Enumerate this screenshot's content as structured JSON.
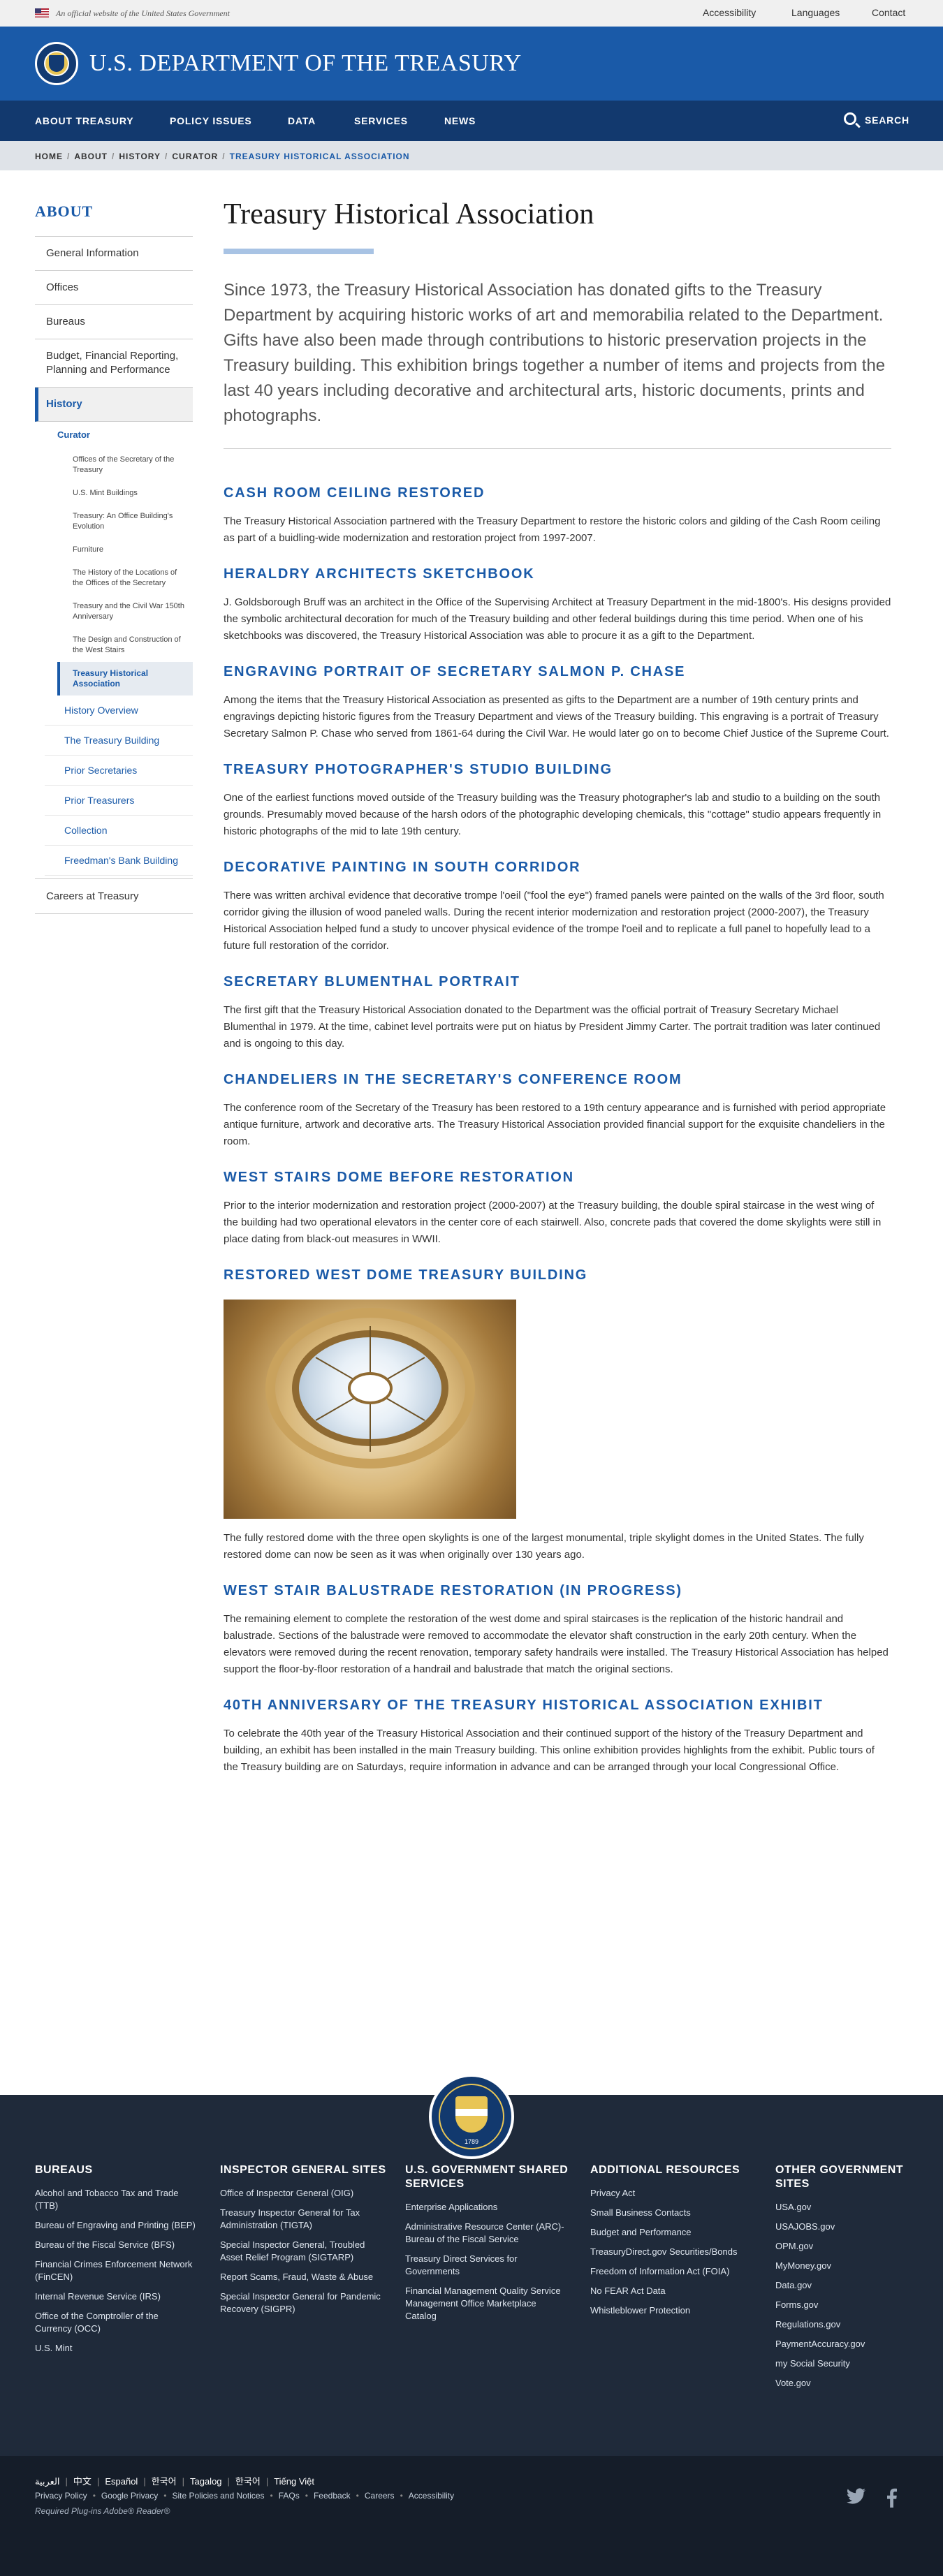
{
  "banner": {
    "official": "An official website of the United States Government",
    "accessibility": "Accessibility",
    "languages": "Languages",
    "contact": "Contact"
  },
  "header": {
    "title": "U.S. DEPARTMENT OF THE TREASURY"
  },
  "nav": {
    "items": [
      "ABOUT TREASURY",
      "POLICY ISSUES",
      "DATA",
      "SERVICES",
      "NEWS"
    ],
    "search": "SEARCH"
  },
  "breadcrumb": [
    "HOME",
    "ABOUT",
    "HISTORY",
    "CURATOR",
    "TREASURY HISTORICAL ASSOCIATION"
  ],
  "sidebar": {
    "heading": "ABOUT",
    "items": [
      "General Information",
      "Offices",
      "Bureaus",
      "Budget, Financial Reporting, Planning and Performance",
      "History"
    ],
    "curator": "Curator",
    "curator_sub": [
      "Offices of the Secretary of the Treasury",
      "U.S. Mint Buildings",
      "Treasury: An Office Building's Evolution",
      "Furniture",
      "The History of the Locations of the Offices of the Secretary",
      "Treasury and the Civil War 150th Anniversary",
      "The Design and Construction of the West Stairs",
      "Treasury Historical Association"
    ],
    "history_sub": [
      "History Overview",
      "The Treasury Building",
      "Prior Secretaries",
      "Prior Treasurers",
      "Collection",
      "Freedman's Bank Building"
    ],
    "careers": "Careers at Treasury"
  },
  "main": {
    "title": "Treasury Historical Association",
    "lede": "Since 1973, the Treasury Historical Association has donated gifts to the Treasury Department by acquiring historic works of art and memorabilia related to the Department. Gifts have also been made through contributions to historic preservation projects in the Treasury building. This exhibition brings together a number of items and projects from the last 40 years including decorative and architectural arts, historic documents, prints and photographs.",
    "sections": [
      {
        "heading": "CASH ROOM CEILING RESTORED",
        "text": "The Treasury Historical Association partnered with the Treasury Department to restore the historic colors and gilding of the Cash Room ceiling as part of a buidling-wide modernization and restoration project from 1997-2007."
      },
      {
        "heading": "HERALDRY ARCHITECTS SKETCHBOOK",
        "text": "J. Goldsborough Bruff was an architect in the Office of the Supervising Architect at Treasury Department in the mid-1800's. His designs provided the symbolic architectural decoration for much of the Treasury building and other federal buildings during this time period. When one of his sketchbooks was discovered, the Treasury Historical Association was able to procure it as a gift to the Department."
      },
      {
        "heading": "ENGRAVING PORTRAIT OF SECRETARY SALMON P. CHASE",
        "text": "Among the items that the Treasury Historical Association as presented as gifts to the Department are a number of 19th century prints and engravings depicting historic figures from the Treasury Department and views of the Treasury building. This engraving is a portrait of Treasury Secretary Salmon P. Chase who served from 1861-64 during the Civil War. He would later go on to become Chief Justice of the Supreme Court."
      },
      {
        "heading": "TREASURY PHOTOGRAPHER'S STUDIO BUILDING",
        "text": "One of the earliest functions moved outside of the Treasury building was the Treasury photographer's lab and studio to a building on the south grounds. Presumably moved because of the harsh odors of the photographic developing chemicals, this \"cottage\" studio appears frequently in historic photographs of the mid to late 19th century."
      },
      {
        "heading": "DECORATIVE PAINTING IN SOUTH CORRIDOR",
        "text": "There was written archival evidence that decorative trompe l'oeil (\"fool the eye\") framed panels were painted on the walls of the 3rd floor, south corridor giving the illusion of wood paneled walls. During the recent interior modernization and restoration project (2000-2007), the Treasury Historical Association helped fund a study to uncover physical evidence of the trompe l'oeil and to replicate a full panel to hopefully lead to a future full restoration of the corridor."
      },
      {
        "heading": "SECRETARY BLUMENTHAL PORTRAIT",
        "text": "The first gift that the Treasury Historical Association donated to the Department was the official portrait of Treasury Secretary Michael Blumenthal in 1979. At the time, cabinet level portraits were put on hiatus by President Jimmy Carter. The portrait tradition was later continued and is ongoing to this day."
      },
      {
        "heading": "CHANDELIERS IN THE SECRETARY'S CONFERENCE ROOM",
        "text": "The conference room of the Secretary of the Treasury has been restored to a 19th century appearance and is furnished with period appropriate antique furniture, artwork and decorative arts. The Treasury Historical Association provided financial support for the exquisite chandeliers in the room."
      },
      {
        "heading": "WEST STAIRS DOME BEFORE RESTORATION",
        "text": "Prior to the interior modernization and restoration project (2000-2007) at the Treasury building, the double spiral staircase in the west wing of the building had two operational elevators in the center core of each stairwell. Also, concrete pads that covered the dome skylights were still in place dating from black-out measures in WWII."
      }
    ],
    "dome_heading": "RESTORED WEST DOME TREASURY BUILDING",
    "dome_text": "The fully restored dome with the three open skylights is one of the largest monumental, triple skylight domes in the United States. The fully restored dome can now be seen as it was when originally over 130 years ago.",
    "sections_after": [
      {
        "heading": "WEST STAIR BALUSTRADE RESTORATION (IN PROGRESS)",
        "text": "The remaining element to complete the restoration of the west dome and spiral staircases is the replication of the historic handrail and balustrade. Sections of the balustrade were removed to accommodate the elevator shaft construction in the early 20th century. When the elevators were removed during the recent renovation, temporary safety handrails were installed. The Treasury Historical Association has helped support the floor-by-floor restoration of a handrail and balustrade that match the original sections."
      },
      {
        "heading": "40TH ANNIVERSARY OF THE TREASURY HISTORICAL ASSOCIATION EXHIBIT",
        "text": "To celebrate the 40th year of the Treasury Historical Association and their continued support of the history of the Treasury Department and building, an exhibit has been installed in the main Treasury building. This online exhibition provides highlights from the exhibit. Public tours of the Treasury building are on Saturdays, require information in advance and can be arranged through your local Congressional Office."
      }
    ]
  },
  "footer": {
    "seal_year": "1789",
    "columns": [
      {
        "heading": "BUREAUS",
        "links": [
          "Alcohol and Tobacco Tax and Trade (TTB)",
          "Bureau of Engraving and Printing (BEP)",
          "Bureau of the Fiscal Service (BFS)",
          "Financial Crimes Enforcement Network (FinCEN)",
          "Internal Revenue Service (IRS)",
          "Office of the Comptroller of the Currency (OCC)",
          "U.S. Mint"
        ]
      },
      {
        "heading": "INSPECTOR GENERAL SITES",
        "links": [
          "Office of Inspector General (OIG)",
          "Treasury Inspector General for Tax Administration (TIGTA)",
          "Special Inspector General, Troubled Asset Relief Program (SIGTARP)",
          "Report Scams, Fraud, Waste & Abuse",
          "Special Inspector General for Pandemic Recovery (SIGPR)"
        ]
      },
      {
        "heading": "U.S. GOVERNMENT SHARED SERVICES",
        "links": [
          "Enterprise Applications",
          "Administrative Resource Center (ARC)- Bureau of the Fiscal Service",
          "Treasury Direct Services for Governments",
          "Financial Management Quality Service Management Office Marketplace Catalog"
        ]
      },
      {
        "heading": "ADDITIONAL RESOURCES",
        "links": [
          "Privacy Act",
          "Small Business Contacts",
          "Budget and Performance",
          "TreasuryDirect.gov Securities/Bonds",
          "Freedom of Information Act (FOIA)",
          "No FEAR Act Data",
          "Whistleblower Protection"
        ]
      },
      {
        "heading": "OTHER GOVERNMENT SITES",
        "links": [
          "USA.gov",
          "USAJOBS.gov",
          "OPM.gov",
          "MyMoney.gov",
          "Data.gov",
          "Forms.gov",
          "Regulations.gov",
          "PaymentAccuracy.gov",
          "my Social Security",
          "Vote.gov"
        ]
      }
    ],
    "languages": [
      "العربية",
      "中文",
      "Español",
      "한국어",
      "Tagalog",
      "한국어",
      "Tiếng Việt"
    ],
    "policies": [
      "Privacy Policy",
      "Google Privacy",
      "Site Policies and Notices",
      "FAQs",
      "Feedback",
      "Careers",
      "Accessibility"
    ],
    "plugins": "Required Plug-ins  Adobe® Reader®"
  },
  "icons": [
    "flag-icon",
    "search-icon",
    "treasury-seal-icon",
    "twitter-icon",
    "facebook-icon"
  ],
  "colors": {
    "primary": "#1a5aa8",
    "nav": "#12396e",
    "footer": "#1f2a3a",
    "footer_bottom": "#151d29"
  }
}
